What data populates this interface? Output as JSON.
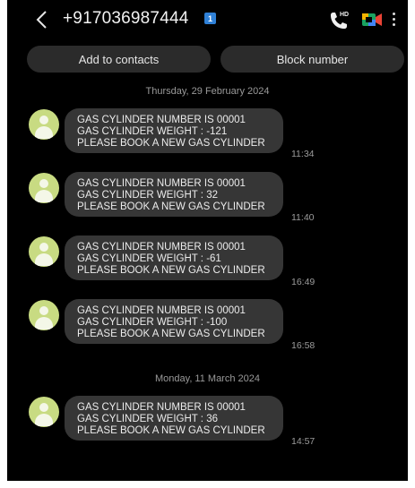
{
  "header": {
    "phone_number": "+917036987444",
    "sim_badge": "1",
    "hd_label": "HD"
  },
  "actions": {
    "add_to_contacts": "Add to contacts",
    "block_number": "Block number"
  },
  "dates": [
    "Thursday, 29 February 2024",
    "Monday, 11 March 2024"
  ],
  "messages": [
    {
      "line1": "GAS CYLINDER NUMBER IS 00001",
      "line2": "GAS CYLINDER WEIGHT : -121",
      "line3": "PLEASE BOOK A NEW GAS CYLINDER",
      "time": "11:34"
    },
    {
      "line1": "GAS CYLINDER NUMBER IS 00001",
      "line2": "GAS CYLINDER WEIGHT : 32",
      "line3": "PLEASE BOOK A NEW GAS CYLINDER",
      "time": "11:40"
    },
    {
      "line1": "GAS CYLINDER NUMBER IS 00001",
      "line2": "GAS CYLINDER WEIGHT : -61",
      "line3": "PLEASE BOOK A NEW GAS CYLINDER",
      "time": "16:49"
    },
    {
      "line1": "GAS CYLINDER NUMBER IS 00001",
      "line2": "GAS CYLINDER WEIGHT : -100",
      "line3": "PLEASE BOOK A NEW GAS CYLINDER",
      "time": "16:58"
    },
    {
      "line1": "GAS CYLINDER NUMBER IS 00001",
      "line2": "GAS CYLINDER WEIGHT : 36",
      "line3": "PLEASE BOOK A NEW GAS CYLINDER",
      "time": "14:57"
    }
  ],
  "colors": {
    "background": "#000000",
    "bubble": "#363636",
    "avatar": "#c8db82",
    "sim_badge": "#2f80d6"
  }
}
